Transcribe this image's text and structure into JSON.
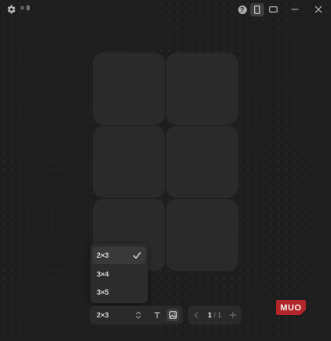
{
  "titlebar": {
    "counter": "= 0",
    "icons": {
      "settings": "gear-icon",
      "help": "help-icon",
      "portrait": "portrait-orientation-icon",
      "landscape": "landscape-orientation-icon",
      "minimize": "minimize-icon",
      "close": "close-icon"
    },
    "help_glyph": "?"
  },
  "grid_dropdown": {
    "options": [
      {
        "label": "2×3",
        "selected": true
      },
      {
        "label": "3×4",
        "selected": false
      },
      {
        "label": "3×5",
        "selected": false
      }
    ]
  },
  "toolbar": {
    "layout_value": "2×3",
    "tools": [
      "text-tool-icon",
      "image-tool-icon"
    ],
    "active_tool": "image-tool-icon"
  },
  "pagination": {
    "current": "1",
    "separator": " / ",
    "total": "1"
  },
  "watermark": {
    "text": "MUO"
  },
  "colors": {
    "background": "#1e1e1e",
    "tile": "#2a2a2a",
    "panel": "#2c2c2c",
    "badge": "#b3262a"
  }
}
